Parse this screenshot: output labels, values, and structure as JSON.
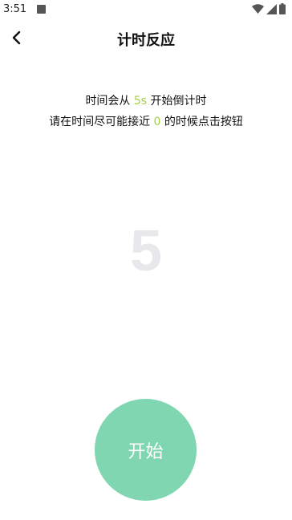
{
  "status_bar": {
    "time": "3:51"
  },
  "header": {
    "title": "计时反应"
  },
  "instructions": {
    "line1_prefix": "时间会从 ",
    "line1_highlight": "5s",
    "line1_suffix": " 开始倒计时",
    "line2_prefix": "请在时间尽可能接近 ",
    "line2_highlight": "0",
    "line2_suffix": " 的时候点击按钮"
  },
  "countdown": {
    "value": "5"
  },
  "start_button": {
    "label": "开始"
  },
  "colors": {
    "accent_green": "#a2d13b",
    "button_green": "#7fd6b1",
    "countdown_gray": "#e8e8ec"
  }
}
